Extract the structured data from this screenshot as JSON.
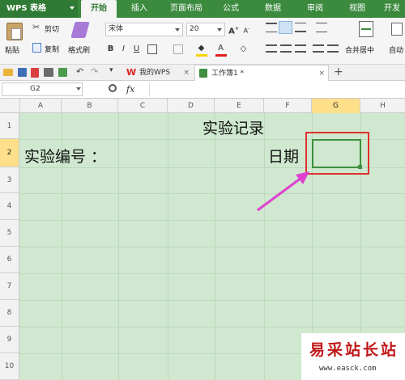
{
  "app": {
    "title": "WPS 表格"
  },
  "menu_tabs": [
    "开始",
    "插入",
    "页面布局",
    "公式",
    "数据",
    "审阅",
    "视图",
    "开发"
  ],
  "ribbon": {
    "paste": "粘贴",
    "cut": "剪切",
    "copy": "复制",
    "format_painter": "格式刷",
    "font_name": "宋体",
    "font_size": "20",
    "merge_center": "合并居中",
    "auto": "自动"
  },
  "doc_tabs": [
    "我的WPS",
    "工作簿1 *"
  ],
  "formula_bar": {
    "cell_ref": "G2",
    "fx": "fx"
  },
  "columns": [
    "A",
    "B",
    "C",
    "D",
    "E",
    "F",
    "G",
    "H"
  ],
  "rows": [
    "1",
    "2",
    "3",
    "4",
    "5",
    "6",
    "7",
    "8",
    "9",
    "10"
  ],
  "cells": {
    "title": "实验记录",
    "experiment_no": "实验编号 ：",
    "date": "日期"
  },
  "watermark": {
    "name": "易采站长站",
    "url": "www.easck.com"
  },
  "colors": {
    "accent": "#3b8a3e",
    "grid_bg": "#cfe8cf",
    "highlight_box": "#e03030",
    "arrow": "#e040d0"
  },
  "selected_cell": "G2"
}
